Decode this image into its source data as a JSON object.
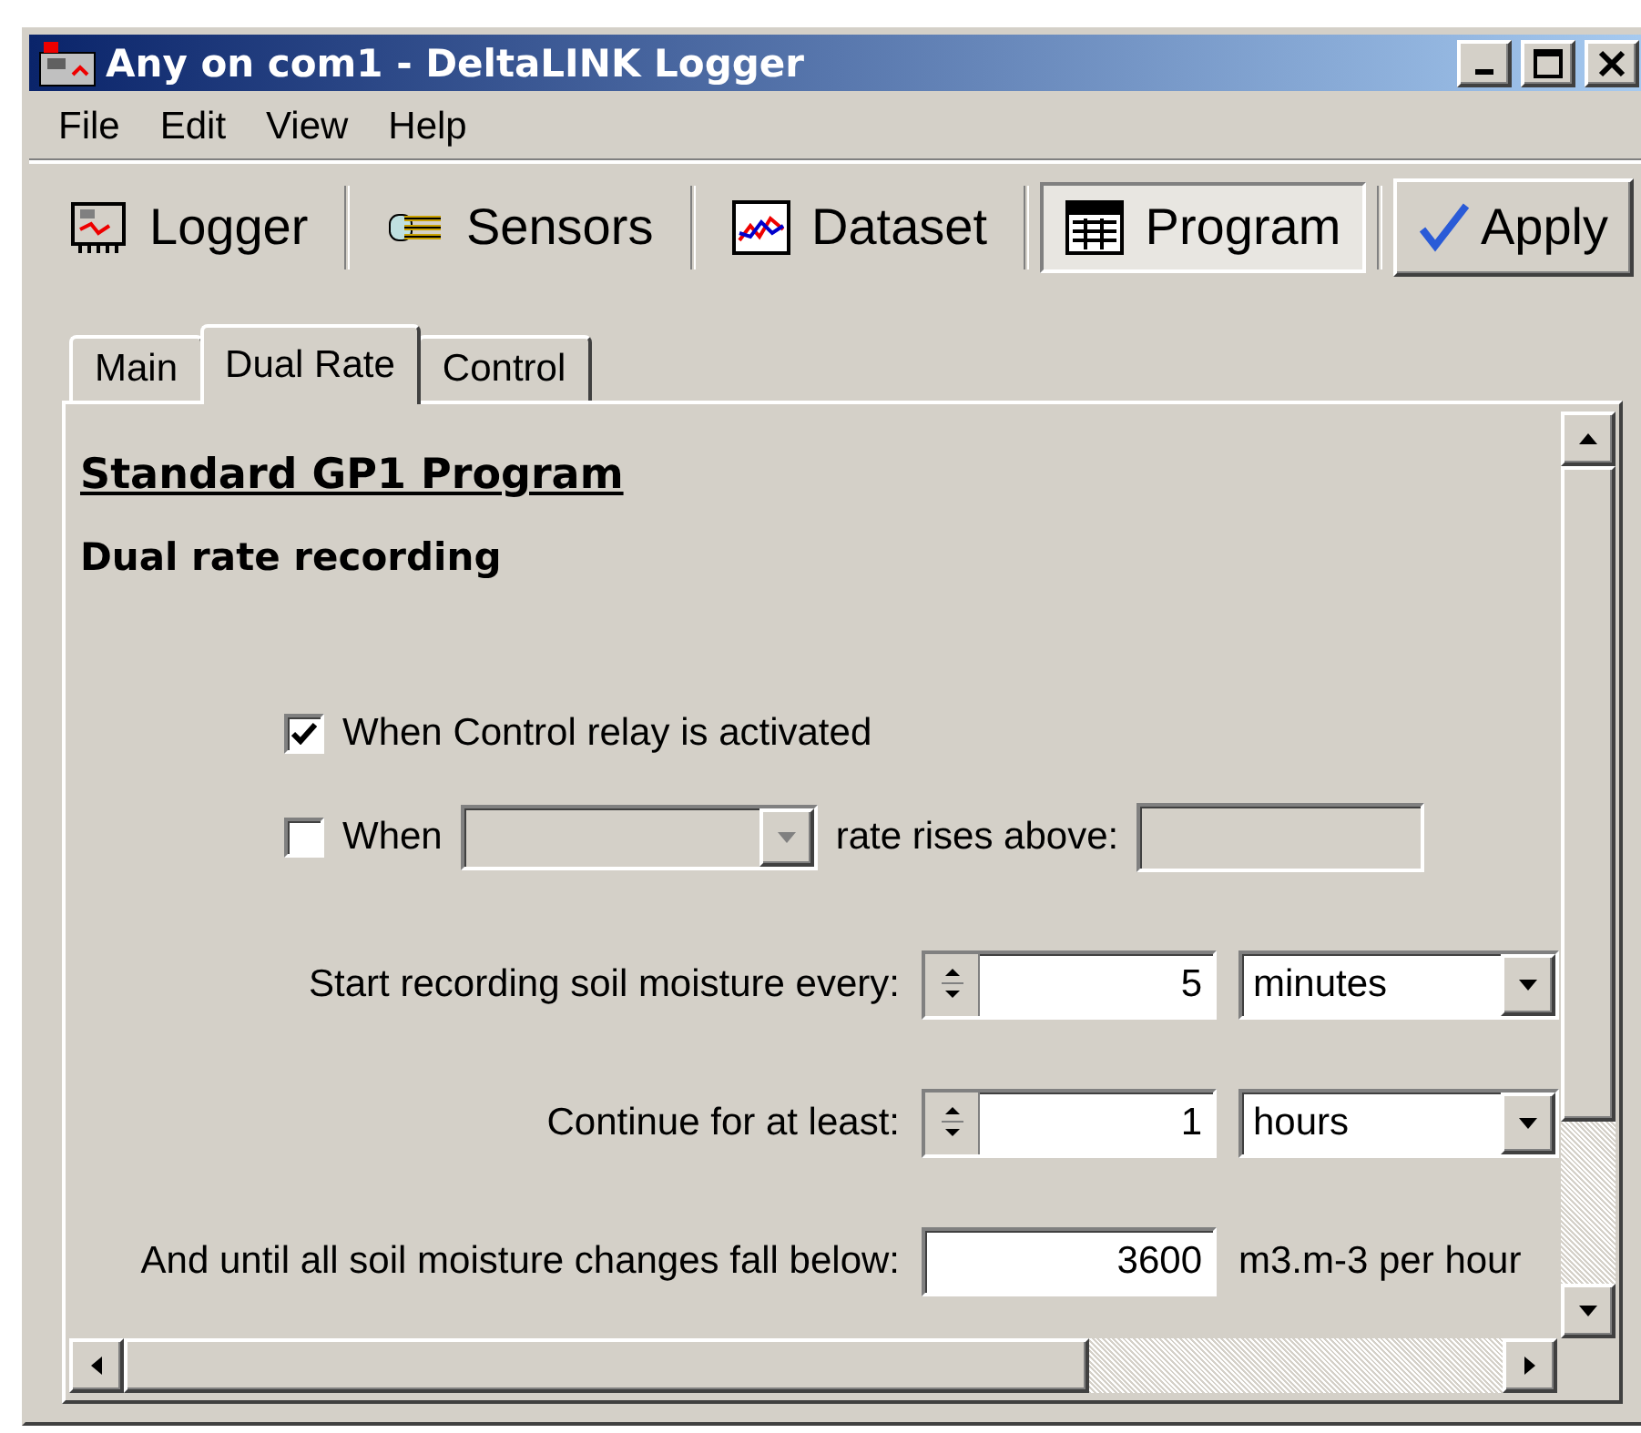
{
  "window": {
    "title": "Any on com1 - DeltaLINK Logger"
  },
  "menu": [
    "File",
    "Edit",
    "View",
    "Help"
  ],
  "toolbar": {
    "items": [
      {
        "label": "Logger",
        "selected": false
      },
      {
        "label": "Sensors",
        "selected": false
      },
      {
        "label": "Dataset",
        "selected": false
      },
      {
        "label": "Program",
        "selected": true
      }
    ],
    "apply": "Apply"
  },
  "tabs": [
    {
      "label": "Main",
      "selected": false
    },
    {
      "label": "Dual Rate",
      "selected": true
    },
    {
      "label": "Control",
      "selected": false
    }
  ],
  "heading": "Standard GP1 Program",
  "subheading": "Dual rate recording",
  "options": [
    {
      "kind": "plain",
      "label": "When Control relay is activated",
      "checked": true
    },
    {
      "kind": "rate",
      "label": "When",
      "suffix": "rate rises above:",
      "checked": false,
      "disabled": true
    }
  ],
  "rows": [
    {
      "kind": "spin",
      "label": "Start recording soil moisture every:",
      "value": "5",
      "unit": "minutes"
    },
    {
      "kind": "spin",
      "label": "Continue for at least:",
      "value": "1",
      "unit": "hours"
    },
    {
      "kind": "text",
      "label": "And until all soil moisture changes fall below:",
      "value": "3600",
      "unit": "m3.m-3 per hour"
    }
  ]
}
